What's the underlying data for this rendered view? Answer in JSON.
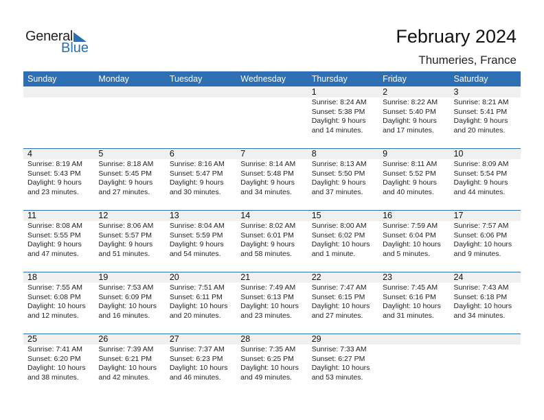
{
  "logo": {
    "word1": "General",
    "word2": "Blue",
    "icon": "triangle-flag-icon",
    "brand_color": "#2a6fb4"
  },
  "header": {
    "title": "February 2024",
    "location": "Thumeries, France"
  },
  "colors": {
    "header_bg": "#2d6fb2",
    "day_band": "#f0f0f0"
  },
  "weekdays": [
    "Sunday",
    "Monday",
    "Tuesday",
    "Wednesday",
    "Thursday",
    "Friday",
    "Saturday"
  ],
  "weeks": [
    [
      null,
      null,
      null,
      null,
      {
        "day": "1",
        "sunrise": "Sunrise: 8:24 AM",
        "sunset": "Sunset: 5:38 PM",
        "daylight1": "Daylight: 9 hours",
        "daylight2": "and 14 minutes."
      },
      {
        "day": "2",
        "sunrise": "Sunrise: 8:22 AM",
        "sunset": "Sunset: 5:40 PM",
        "daylight1": "Daylight: 9 hours",
        "daylight2": "and 17 minutes."
      },
      {
        "day": "3",
        "sunrise": "Sunrise: 8:21 AM",
        "sunset": "Sunset: 5:41 PM",
        "daylight1": "Daylight: 9 hours",
        "daylight2": "and 20 minutes."
      }
    ],
    [
      {
        "day": "4",
        "sunrise": "Sunrise: 8:19 AM",
        "sunset": "Sunset: 5:43 PM",
        "daylight1": "Daylight: 9 hours",
        "daylight2": "and 23 minutes."
      },
      {
        "day": "5",
        "sunrise": "Sunrise: 8:18 AM",
        "sunset": "Sunset: 5:45 PM",
        "daylight1": "Daylight: 9 hours",
        "daylight2": "and 27 minutes."
      },
      {
        "day": "6",
        "sunrise": "Sunrise: 8:16 AM",
        "sunset": "Sunset: 5:47 PM",
        "daylight1": "Daylight: 9 hours",
        "daylight2": "and 30 minutes."
      },
      {
        "day": "7",
        "sunrise": "Sunrise: 8:14 AM",
        "sunset": "Sunset: 5:48 PM",
        "daylight1": "Daylight: 9 hours",
        "daylight2": "and 34 minutes."
      },
      {
        "day": "8",
        "sunrise": "Sunrise: 8:13 AM",
        "sunset": "Sunset: 5:50 PM",
        "daylight1": "Daylight: 9 hours",
        "daylight2": "and 37 minutes."
      },
      {
        "day": "9",
        "sunrise": "Sunrise: 8:11 AM",
        "sunset": "Sunset: 5:52 PM",
        "daylight1": "Daylight: 9 hours",
        "daylight2": "and 40 minutes."
      },
      {
        "day": "10",
        "sunrise": "Sunrise: 8:09 AM",
        "sunset": "Sunset: 5:54 PM",
        "daylight1": "Daylight: 9 hours",
        "daylight2": "and 44 minutes."
      }
    ],
    [
      {
        "day": "11",
        "sunrise": "Sunrise: 8:08 AM",
        "sunset": "Sunset: 5:55 PM",
        "daylight1": "Daylight: 9 hours",
        "daylight2": "and 47 minutes."
      },
      {
        "day": "12",
        "sunrise": "Sunrise: 8:06 AM",
        "sunset": "Sunset: 5:57 PM",
        "daylight1": "Daylight: 9 hours",
        "daylight2": "and 51 minutes."
      },
      {
        "day": "13",
        "sunrise": "Sunrise: 8:04 AM",
        "sunset": "Sunset: 5:59 PM",
        "daylight1": "Daylight: 9 hours",
        "daylight2": "and 54 minutes."
      },
      {
        "day": "14",
        "sunrise": "Sunrise: 8:02 AM",
        "sunset": "Sunset: 6:01 PM",
        "daylight1": "Daylight: 9 hours",
        "daylight2": "and 58 minutes."
      },
      {
        "day": "15",
        "sunrise": "Sunrise: 8:00 AM",
        "sunset": "Sunset: 6:02 PM",
        "daylight1": "Daylight: 10 hours",
        "daylight2": "and 1 minute."
      },
      {
        "day": "16",
        "sunrise": "Sunrise: 7:59 AM",
        "sunset": "Sunset: 6:04 PM",
        "daylight1": "Daylight: 10 hours",
        "daylight2": "and 5 minutes."
      },
      {
        "day": "17",
        "sunrise": "Sunrise: 7:57 AM",
        "sunset": "Sunset: 6:06 PM",
        "daylight1": "Daylight: 10 hours",
        "daylight2": "and 9 minutes."
      }
    ],
    [
      {
        "day": "18",
        "sunrise": "Sunrise: 7:55 AM",
        "sunset": "Sunset: 6:08 PM",
        "daylight1": "Daylight: 10 hours",
        "daylight2": "and 12 minutes."
      },
      {
        "day": "19",
        "sunrise": "Sunrise: 7:53 AM",
        "sunset": "Sunset: 6:09 PM",
        "daylight1": "Daylight: 10 hours",
        "daylight2": "and 16 minutes."
      },
      {
        "day": "20",
        "sunrise": "Sunrise: 7:51 AM",
        "sunset": "Sunset: 6:11 PM",
        "daylight1": "Daylight: 10 hours",
        "daylight2": "and 20 minutes."
      },
      {
        "day": "21",
        "sunrise": "Sunrise: 7:49 AM",
        "sunset": "Sunset: 6:13 PM",
        "daylight1": "Daylight: 10 hours",
        "daylight2": "and 23 minutes."
      },
      {
        "day": "22",
        "sunrise": "Sunrise: 7:47 AM",
        "sunset": "Sunset: 6:15 PM",
        "daylight1": "Daylight: 10 hours",
        "daylight2": "and 27 minutes."
      },
      {
        "day": "23",
        "sunrise": "Sunrise: 7:45 AM",
        "sunset": "Sunset: 6:16 PM",
        "daylight1": "Daylight: 10 hours",
        "daylight2": "and 31 minutes."
      },
      {
        "day": "24",
        "sunrise": "Sunrise: 7:43 AM",
        "sunset": "Sunset: 6:18 PM",
        "daylight1": "Daylight: 10 hours",
        "daylight2": "and 34 minutes."
      }
    ],
    [
      {
        "day": "25",
        "sunrise": "Sunrise: 7:41 AM",
        "sunset": "Sunset: 6:20 PM",
        "daylight1": "Daylight: 10 hours",
        "daylight2": "and 38 minutes."
      },
      {
        "day": "26",
        "sunrise": "Sunrise: 7:39 AM",
        "sunset": "Sunset: 6:21 PM",
        "daylight1": "Daylight: 10 hours",
        "daylight2": "and 42 minutes."
      },
      {
        "day": "27",
        "sunrise": "Sunrise: 7:37 AM",
        "sunset": "Sunset: 6:23 PM",
        "daylight1": "Daylight: 10 hours",
        "daylight2": "and 46 minutes."
      },
      {
        "day": "28",
        "sunrise": "Sunrise: 7:35 AM",
        "sunset": "Sunset: 6:25 PM",
        "daylight1": "Daylight: 10 hours",
        "daylight2": "and 49 minutes."
      },
      {
        "day": "29",
        "sunrise": "Sunrise: 7:33 AM",
        "sunset": "Sunset: 6:27 PM",
        "daylight1": "Daylight: 10 hours",
        "daylight2": "and 53 minutes."
      },
      null,
      null
    ]
  ]
}
